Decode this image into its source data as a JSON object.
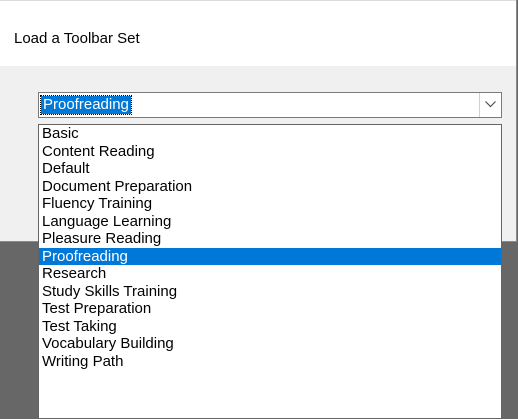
{
  "dialog": {
    "title": "Load a Toolbar Set"
  },
  "combo": {
    "selected_value": "Proofreading",
    "dropdown_icon": "chevron-down-icon"
  },
  "dropdown": {
    "options": [
      "Basic",
      "Content Reading",
      "Default",
      "Document Preparation",
      "Fluency Training",
      "Language Learning",
      "Pleasure Reading",
      "Proofreading",
      "Research",
      "Study Skills Training",
      "Test Preparation",
      "Test Taking",
      "Vocabulary Building",
      "Writing Path"
    ],
    "highlighted_index": 7
  },
  "colors": {
    "selection": "#0078d7",
    "background_outside": "#676767",
    "dialog_body": "#f0f0f0"
  }
}
